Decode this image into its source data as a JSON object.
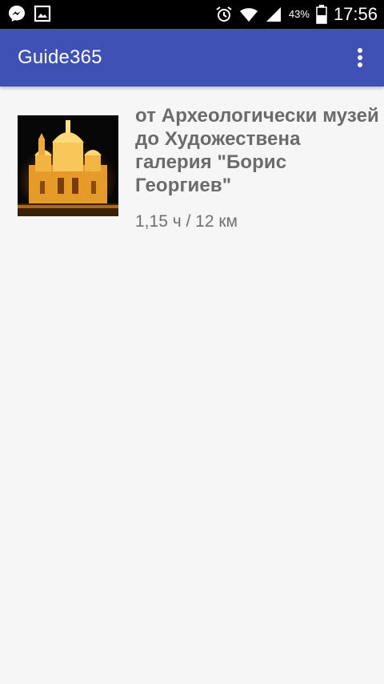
{
  "status_bar": {
    "time": "17:56",
    "battery_percent": "43%",
    "icons": [
      "messenger-icon",
      "image-notification-icon",
      "alarm-icon",
      "wifi-icon",
      "signal-icon",
      "battery-icon"
    ]
  },
  "app_bar": {
    "title": "Guide365",
    "menu_icon": "overflow-menu-icon",
    "color": "#3f51b5"
  },
  "routes": [
    {
      "title": "от Археологически музей до Художествена галерия \"Борис Георгиев\"",
      "meta": "1,15 ч / 12 км",
      "thumbnail": "illuminated-cathedral-night-image"
    }
  ]
}
